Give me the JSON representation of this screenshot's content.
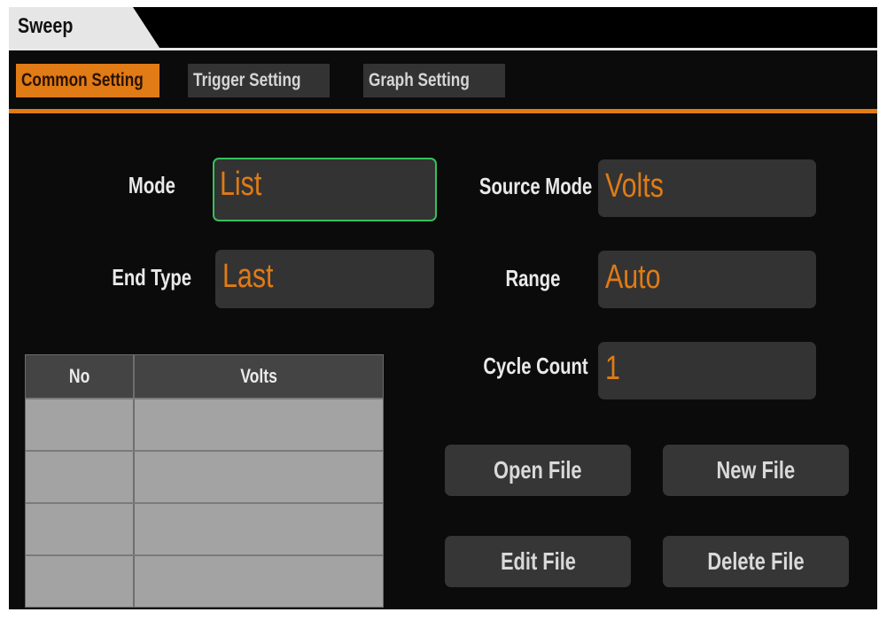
{
  "window": {
    "title": "Sweep"
  },
  "tabs": [
    {
      "label": "Common Setting",
      "active": true
    },
    {
      "label": "Trigger Setting",
      "active": false
    },
    {
      "label": "Graph Setting",
      "active": false
    }
  ],
  "form": {
    "mode": {
      "label": "Mode",
      "value": "List"
    },
    "end_type": {
      "label": "End Type",
      "value": "Last"
    },
    "source_mode": {
      "label": "Source Mode",
      "value": "Volts"
    },
    "range": {
      "label": "Range",
      "value": "Auto"
    },
    "cycle_count": {
      "label": "Cycle Count",
      "value": "1"
    }
  },
  "table": {
    "columns": [
      "No",
      "Volts"
    ],
    "rows": [
      [
        "",
        ""
      ],
      [
        "",
        ""
      ],
      [
        "",
        ""
      ],
      [
        "",
        ""
      ]
    ]
  },
  "buttons": {
    "open_file": "Open File",
    "new_file": "New File",
    "edit_file": "Edit File",
    "delete_file": "Delete File"
  },
  "colors": {
    "accent": "#e07b15",
    "background": "#0b0b0b",
    "field_bg": "#333333",
    "focus": "#35c15a",
    "table_bg": "#a3a3a3"
  }
}
